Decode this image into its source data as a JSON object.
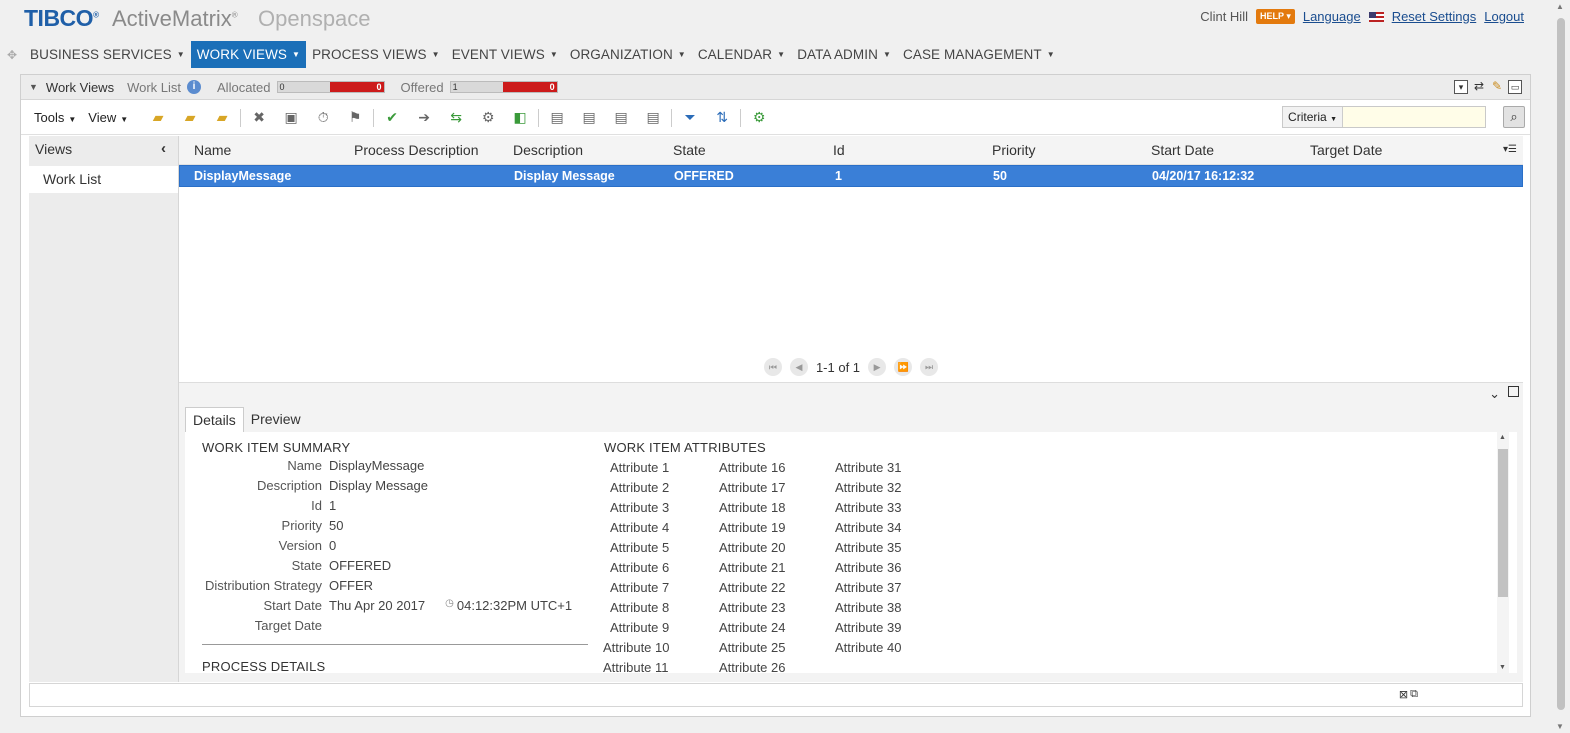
{
  "header": {
    "brand": "TIBCO",
    "product": "ActiveMatrix",
    "subproduct": "Openspace",
    "user_name": "Clint Hill",
    "help_label": "HELP",
    "language_link": "Language",
    "reset_link": "Reset Settings",
    "logout_link": "Logout"
  },
  "nav": {
    "items": [
      {
        "label": "BUSINESS SERVICES",
        "active": false
      },
      {
        "label": "WORK VIEWS",
        "active": true
      },
      {
        "label": "PROCESS VIEWS",
        "active": false
      },
      {
        "label": "EVENT VIEWS",
        "active": false
      },
      {
        "label": "ORGANIZATION",
        "active": false
      },
      {
        "label": "CALENDAR",
        "active": false
      },
      {
        "label": "DATA ADMIN",
        "active": false
      },
      {
        "label": "CASE MANAGEMENT",
        "active": false
      }
    ]
  },
  "panel": {
    "title": "Work Views",
    "subtitle": "Work List",
    "allocated_label": "Allocated",
    "allocated_count": "0",
    "allocated_flag": "0",
    "offered_label": "Offered",
    "offered_count": "1",
    "offered_flag": "0"
  },
  "toolbar": {
    "tools_label": "Tools",
    "view_label": "View",
    "criteria_label": "Criteria",
    "search_value": ""
  },
  "sidebar": {
    "title": "Views",
    "items": [
      "Work List"
    ]
  },
  "grid": {
    "columns": [
      "Name",
      "Process Description",
      "Description",
      "State",
      "Id",
      "Priority",
      "Start Date",
      "Target Date"
    ],
    "rows": [
      [
        "DisplayMessage",
        "",
        "Display Message",
        "OFFERED",
        "1",
        "50",
        "04/20/17 16:12:32",
        ""
      ]
    ],
    "pager_text": "1-1 of 1"
  },
  "details": {
    "tabs": [
      "Details",
      "Preview"
    ],
    "summary_title": "WORK ITEM SUMMARY",
    "summary": [
      {
        "key": "Name",
        "value": "DisplayMessage"
      },
      {
        "key": "Description",
        "value": "Display Message"
      },
      {
        "key": "Id",
        "value": "1"
      },
      {
        "key": "Priority",
        "value": "50"
      },
      {
        "key": "Version",
        "value": "0"
      },
      {
        "key": "State",
        "value": "OFFERED"
      },
      {
        "key": "Distribution Strategy",
        "value": "OFFER"
      },
      {
        "key": "Start Date",
        "value": "Thu Apr 20 2017"
      },
      {
        "key": "Target Date",
        "value": ""
      }
    ],
    "start_time": "04:12:32PM UTC+1",
    "process_title": "PROCESS DETAILS",
    "attributes_title": "WORK ITEM ATTRIBUTES",
    "attributes_col1": [
      "Attribute 1",
      "Attribute 2",
      "Attribute 3",
      "Attribute 4",
      "Attribute 5",
      "Attribute 6",
      "Attribute 7",
      "Attribute 8",
      "Attribute 9",
      "Attribute 10",
      "Attribute 11"
    ],
    "attributes_col2": [
      "Attribute 16",
      "Attribute 17",
      "Attribute 18",
      "Attribute 19",
      "Attribute 20",
      "Attribute 21",
      "Attribute 22",
      "Attribute 23",
      "Attribute 24",
      "Attribute 25",
      "Attribute 26"
    ],
    "attributes_col3": [
      "Attribute 31",
      "Attribute 32",
      "Attribute 33",
      "Attribute 34",
      "Attribute 35",
      "Attribute 36",
      "Attribute 37",
      "Attribute 38",
      "Attribute 39",
      "Attribute 40"
    ]
  },
  "colors": {
    "accent": "#1b6fb8",
    "selected_row": "#3a7fd7",
    "alert_red": "#cc1a1a",
    "help_orange": "#e37a0e"
  }
}
